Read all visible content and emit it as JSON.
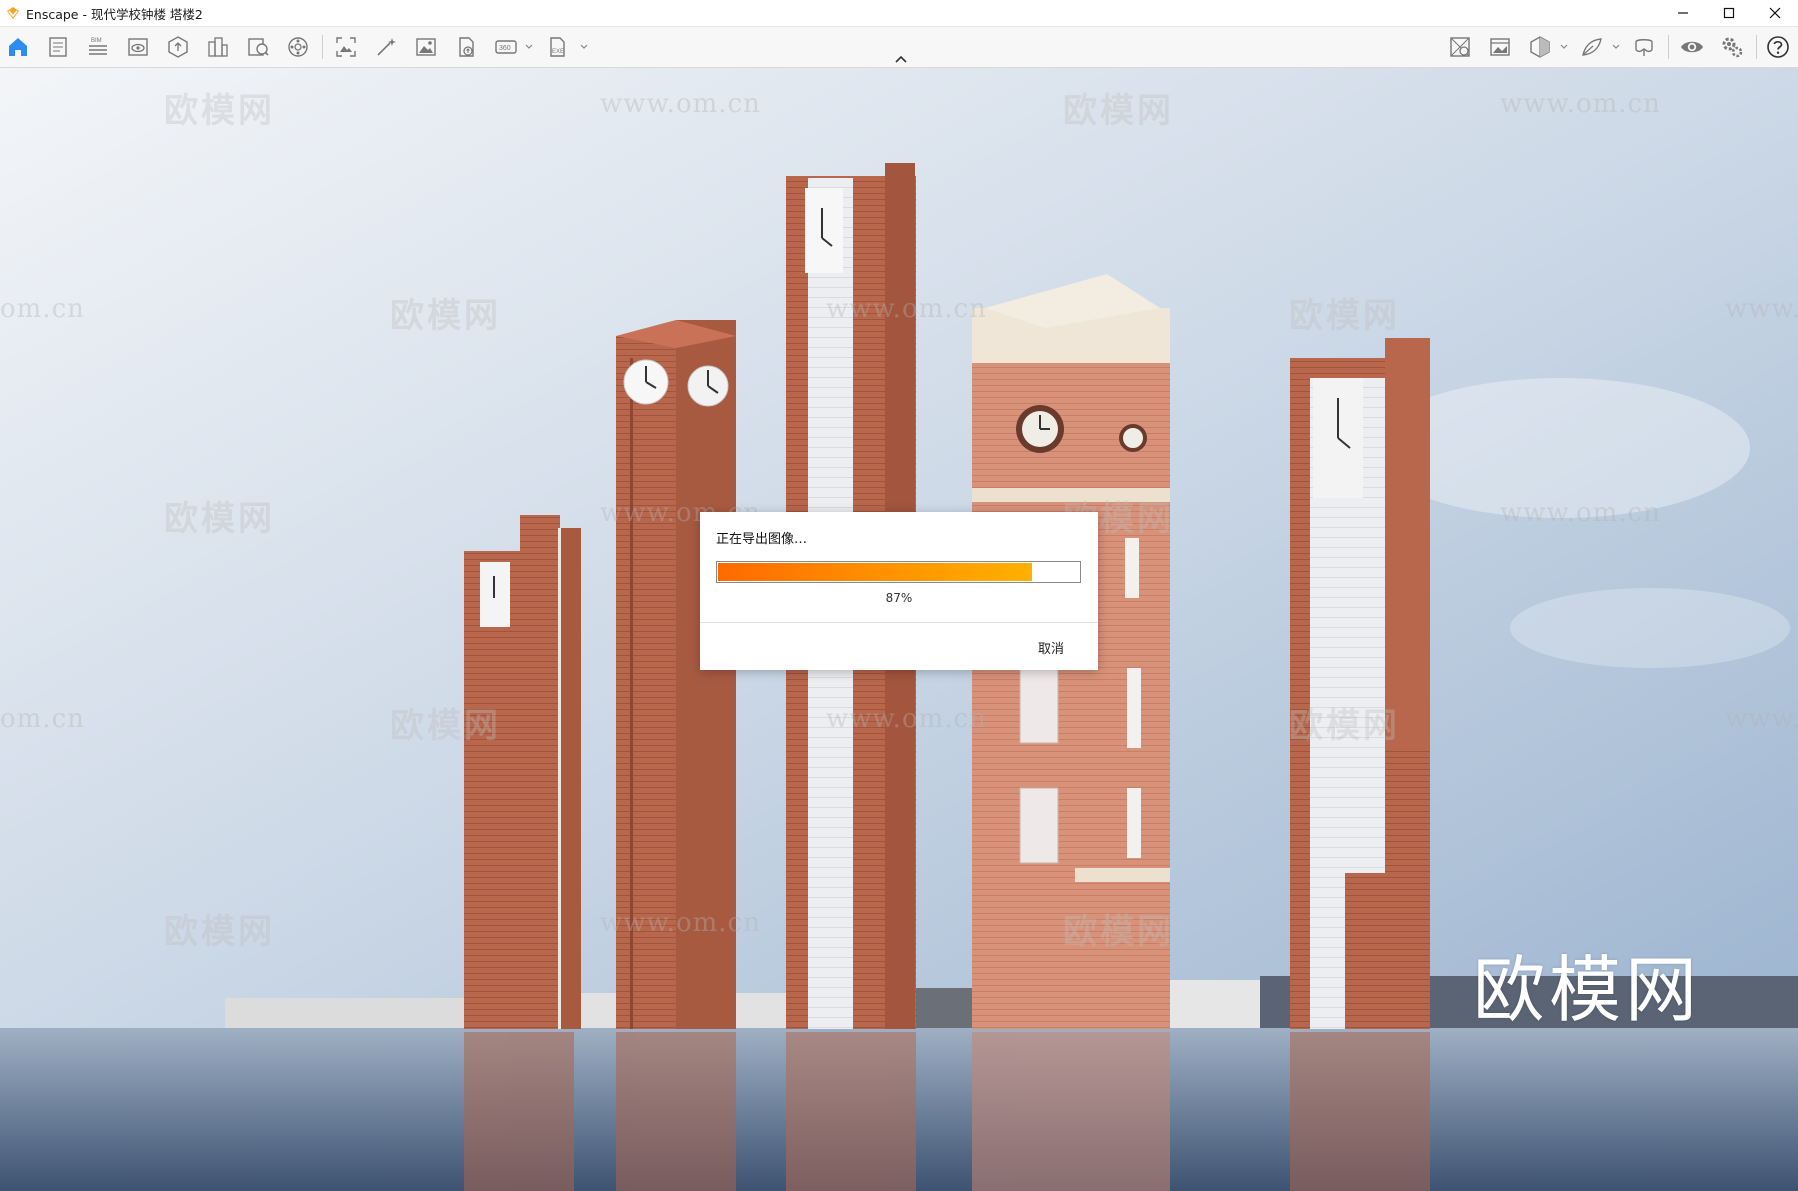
{
  "window": {
    "title": "Enscape - 现代学校钟楼 塔楼2",
    "accent_color": "#f5a623"
  },
  "toolbar": {
    "left_icons": [
      "home-icon",
      "project-file-icon",
      "bim-icon",
      "views-icon",
      "asset-library-icon",
      "site-context-icon",
      "material-editor-icon",
      "atmosphere-icon",
      "screenshot-icon",
      "batch-render-icon",
      "render-image-icon",
      "upload-icon",
      "panorama-360-icon",
      "export-exe-icon"
    ],
    "right_icons": [
      "views-manager-icon",
      "visual-settings-icon",
      "view-cube-icon",
      "feedback-icon",
      "vr-headset-icon",
      "capture-eye-icon",
      "settings-icon",
      "help-icon"
    ],
    "bim_label": "BIM",
    "exe_label": "EXE",
    "pano_label": "360"
  },
  "export_dialog": {
    "title": "正在导出图像…",
    "progress": 0.87,
    "progress_text": "87%",
    "cancel_label": "取消"
  },
  "watermark": {
    "brand_cn": "欧模网",
    "site": "www.om.cn",
    "site_partial_left": "om.cn",
    "site_partial_right": "www.",
    "large": "欧模网"
  }
}
